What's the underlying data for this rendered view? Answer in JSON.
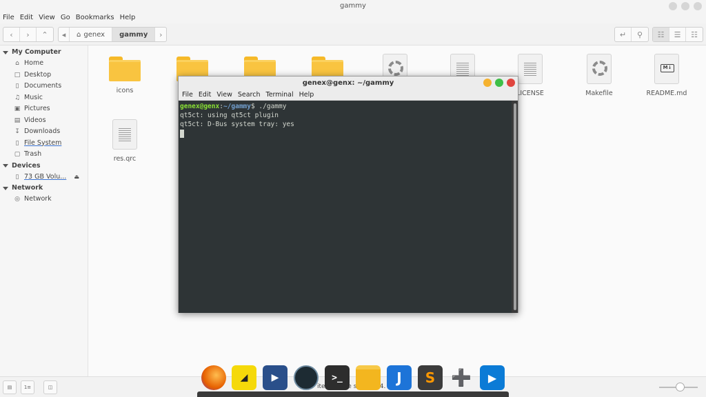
{
  "window": {
    "title": "gammy"
  },
  "menubar": [
    "File",
    "Edit",
    "View",
    "Go",
    "Bookmarks",
    "Help"
  ],
  "toolbar": {
    "breadcrumbs": [
      "genex",
      "gammy"
    ]
  },
  "sidebar": {
    "sections": [
      {
        "header": "My Computer",
        "items": [
          {
            "label": "Home",
            "icon": "home-icon"
          },
          {
            "label": "Desktop",
            "icon": "desktop-icon"
          },
          {
            "label": "Documents",
            "icon": "documents-icon"
          },
          {
            "label": "Music",
            "icon": "music-icon"
          },
          {
            "label": "Pictures",
            "icon": "pictures-icon"
          },
          {
            "label": "Videos",
            "icon": "videos-icon"
          },
          {
            "label": "Downloads",
            "icon": "downloads-icon"
          },
          {
            "label": "File System",
            "icon": "drive-icon"
          },
          {
            "label": "Trash",
            "icon": "trash-icon"
          }
        ]
      },
      {
        "header": "Devices",
        "items": [
          {
            "label": "73 GB Volu...",
            "icon": "drive-icon"
          }
        ]
      },
      {
        "header": "Network",
        "items": [
          {
            "label": "Network",
            "icon": "network-icon"
          }
        ]
      }
    ]
  },
  "files": [
    {
      "name": "icons",
      "type": "folder"
    },
    {
      "name": "",
      "type": "folder"
    },
    {
      "name": "",
      "type": "folder"
    },
    {
      "name": "",
      "type": "folder"
    },
    {
      "name": "",
      "type": "settings-file"
    },
    {
      "name": "",
      "type": "text-file"
    },
    {
      "name": "LICENSE",
      "type": "text-file"
    },
    {
      "name": "Makefile",
      "type": "settings-file"
    },
    {
      "name": "README.md",
      "type": "markdown-file"
    },
    {
      "name": "res.qrc",
      "type": "text-file"
    }
  ],
  "status": {
    "text": "items, Free space: 24."
  },
  "terminal": {
    "title": "genex@genx: ~/gammy",
    "menu": [
      "File",
      "Edit",
      "View",
      "Search",
      "Terminal",
      "Help"
    ],
    "prompt_user": "genex@genx",
    "prompt_path": "~/gammy",
    "command": "$ ./gammy",
    "output": [
      "qt5ct: using qt5ct plugin",
      "qt5ct: D-Bus system tray: yes"
    ]
  },
  "dock": [
    {
      "name": "firefox-icon",
      "color": "#e66000"
    },
    {
      "name": "sticky-notes-icon",
      "color": "#f5d90a"
    },
    {
      "name": "video-editor-icon",
      "color": "#2a4f8a"
    },
    {
      "name": "system-monitor-icon",
      "color": "#1d2b33"
    },
    {
      "name": "terminal-icon",
      "color": "#2d2d2d"
    },
    {
      "name": "files-icon",
      "color": "#f3b61f"
    },
    {
      "name": "joplin-icon",
      "color": "#1d74d8"
    },
    {
      "name": "sublime-text-icon",
      "color": "#3b3b3b"
    },
    {
      "name": "app-add-icon",
      "color": "#1e88e5"
    },
    {
      "name": "media-player-icon",
      "color": "#0b7bd6"
    }
  ]
}
